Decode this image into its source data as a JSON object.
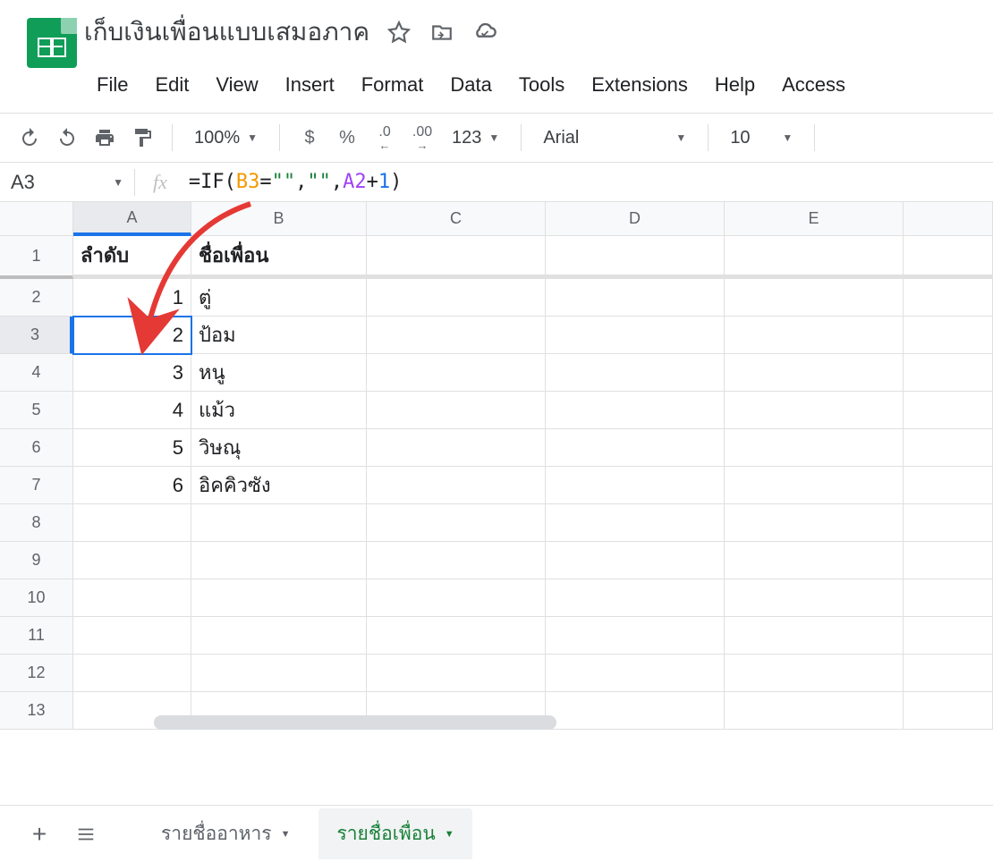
{
  "doc_title": "เก็บเงินเพื่อนแบบเสมอภาค",
  "menu": [
    "File",
    "Edit",
    "View",
    "Insert",
    "Format",
    "Data",
    "Tools",
    "Extensions",
    "Help",
    "Access"
  ],
  "toolbar": {
    "zoom": "100%",
    "font": "Arial",
    "font_size": "10",
    "currency": "$",
    "percent": "%",
    "dec_dec": ".0",
    "inc_dec": ".00",
    "num_fmt": "123"
  },
  "name_box": "A3",
  "fx_label": "fx",
  "formula": {
    "prefix": "=IF",
    "open": "(",
    "arg1": "B3",
    "eq": "=",
    "str1": "\"\"",
    "comma1": ",",
    "str2": "\"\"",
    "comma2": ",",
    "arg3a": "A2",
    "plus": "+",
    "arg3b": "1",
    "close": ")"
  },
  "columns": [
    "A",
    "B",
    "C",
    "D",
    "E"
  ],
  "row_numbers": [
    "1",
    "2",
    "3",
    "4",
    "5",
    "6",
    "7",
    "8",
    "9",
    "10",
    "11",
    "12",
    "13"
  ],
  "headers": {
    "A": "ลำดับ",
    "B": "ชื่อเพื่อน"
  },
  "rows": [
    {
      "a": "1",
      "b": "ตู่"
    },
    {
      "a": "2",
      "b": "ป้อม"
    },
    {
      "a": "3",
      "b": "หนู"
    },
    {
      "a": "4",
      "b": "แม้ว"
    },
    {
      "a": "5",
      "b": "วิษณุ"
    },
    {
      "a": "6",
      "b": "อิคคิวซัง"
    }
  ],
  "sheets": {
    "tab1": "รายชื่ออาหาร",
    "tab2": "รายชื่อเพื่อน"
  }
}
